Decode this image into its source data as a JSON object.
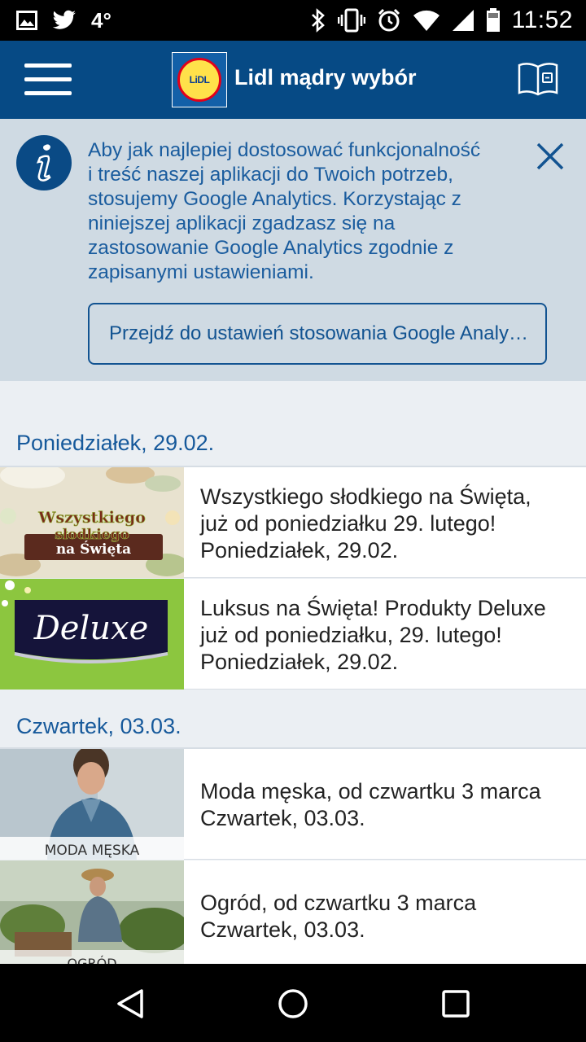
{
  "status_bar": {
    "temperature": "4°",
    "time": "11:52",
    "left_icons": [
      "gallery-icon",
      "twitter-icon"
    ],
    "right_icons": [
      "bluetooth-icon",
      "vibrate-icon",
      "alarm-icon",
      "wifi-icon",
      "signal-icon",
      "battery-icon"
    ]
  },
  "app_bar": {
    "logo_text": "LiDL",
    "title": "Lidl mądry wybór"
  },
  "notice": {
    "lines": [
      "Aby jak najlepiej dostosować funkcjonalność",
      "i treść naszej aplikacji do Twoich potrzeb,",
      "stosujemy Google Analytics. Korzystając z",
      "niniejszej aplikacji zgadzasz się na",
      "zastosowanie Google Analytics zgodnie z",
      "zapisanymi ustawieniami."
    ],
    "button_label": "Przejdź do ustawień stosowania Google Analytics"
  },
  "sections": [
    {
      "header": "Poniedziałek, 29.02.",
      "items": [
        {
          "lines": [
            "Wszystkiego słodkiego na Święta,",
            "już od poniedziałku 29. lutego!",
            "Poniedziałek, 29.02."
          ],
          "thumb_text": [
            "Wszystkiego",
            "słodkiego",
            "na Święta"
          ]
        },
        {
          "lines": [
            "Luksus na Święta! Produkty Deluxe",
            "już od poniedziałku, 29. lutego!",
            "Poniedziałek, 29.02."
          ],
          "thumb_text": [
            "Deluxe"
          ]
        }
      ]
    },
    {
      "header": "Czwartek, 03.03.",
      "items": [
        {
          "lines": [
            "Moda męska, od czwartku 3 marca",
            "Czwartek, 03.03."
          ],
          "thumb_text": [
            "MODA MĘSKA"
          ]
        },
        {
          "lines": [
            "Ogród, od czwartku 3 marca",
            "Czwartek, 03.03."
          ],
          "thumb_text": [
            "OGRÓD"
          ]
        }
      ]
    }
  ],
  "colors": {
    "app_bar": "#064a85",
    "notice_bg": "#cfdae3",
    "accent_text": "#16599b",
    "content_bg": "#ebeff3"
  }
}
